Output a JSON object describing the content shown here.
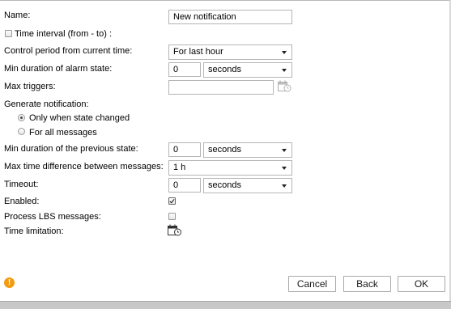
{
  "form": {
    "name_label": "Name:",
    "name_value": "New notification",
    "time_interval_label": "Time interval (from - to) :",
    "control_period_label": "Control period from current time:",
    "control_period_value": "For last hour",
    "min_duration_alarm_label": "Min duration of alarm state:",
    "min_duration_alarm_value": "0",
    "min_duration_alarm_unit": "seconds",
    "max_triggers_label": "Max triggers:",
    "max_triggers_value": "",
    "generate_notification_label": "Generate notification:",
    "radio_only_changed_label": "Only when state changed",
    "radio_all_messages_label": "For all messages",
    "min_duration_prev_label": "Min duration of the previous state:",
    "min_duration_prev_value": "0",
    "min_duration_prev_unit": "seconds",
    "max_time_diff_label": "Max time difference between messages:",
    "max_time_diff_value": "1 h",
    "timeout_label": "Timeout:",
    "timeout_value": "0",
    "timeout_unit": "seconds",
    "enabled_label": "Enabled:",
    "enabled_checked": true,
    "process_lbs_label": "Process LBS messages:",
    "process_lbs_checked": false,
    "time_limitation_label": "Time limitation:",
    "time_interval_checked": false,
    "generate_mode": "only_changed"
  },
  "footer": {
    "cancel_label": "Cancel",
    "back_label": "Back",
    "ok_label": "OK",
    "warning_icon_text": "!"
  },
  "colors": {
    "warning": "#f39c12",
    "border": "#b5b5b5"
  },
  "icons": {
    "schedule": "calendar-clock-icon",
    "warning": "warning-icon"
  }
}
